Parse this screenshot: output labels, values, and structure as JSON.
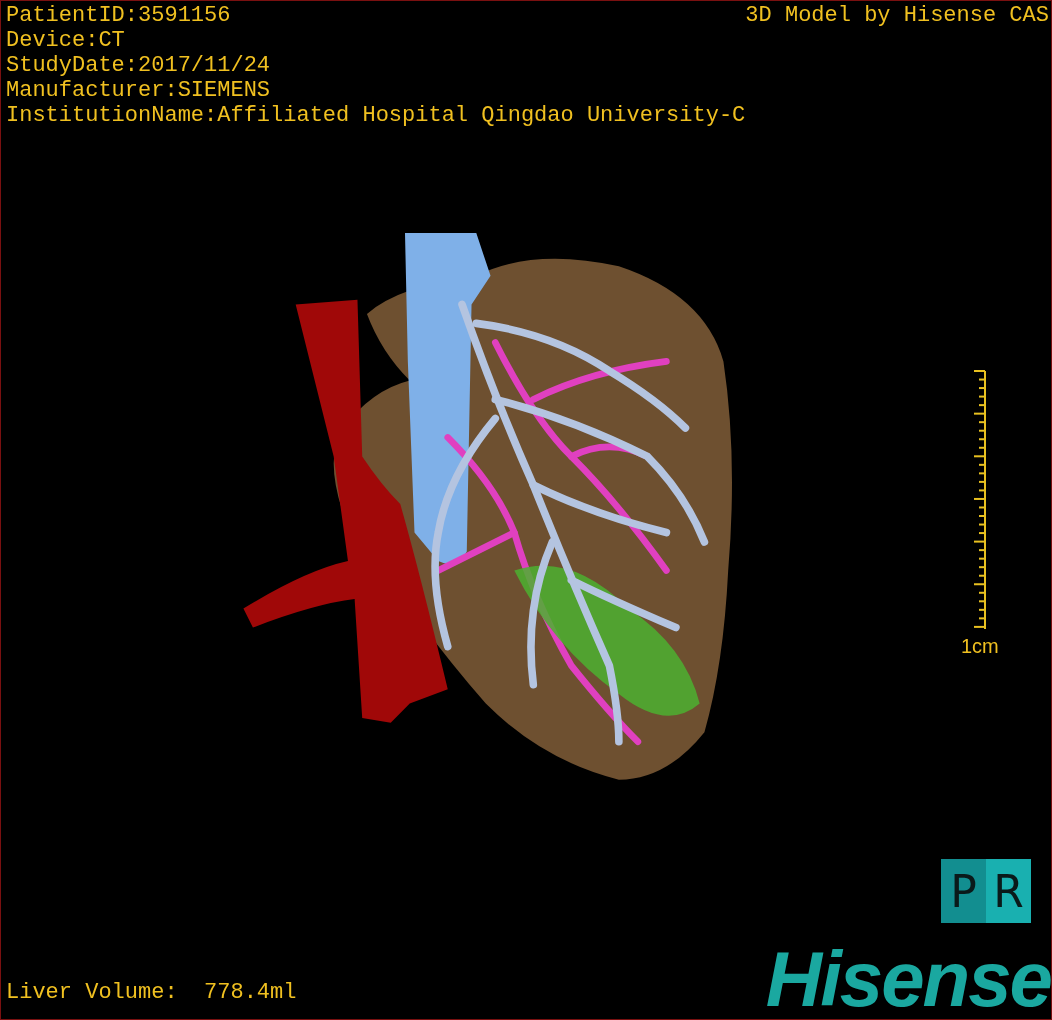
{
  "info_lines": [
    "PatientID:3591156",
    "Device:CT",
    "StudyDate:2017/11/24",
    "Manufacturer:SIEMENS",
    "InstitutionName:Affiliated Hospital Qingdao University-C"
  ],
  "title": "3D Model by Hisense CAS",
  "scale": {
    "label": "1cm"
  },
  "volume": "Liver Volume:  778.4ml",
  "pr_button": {
    "letters": [
      "P",
      "R"
    ]
  },
  "logo": "Hisense"
}
